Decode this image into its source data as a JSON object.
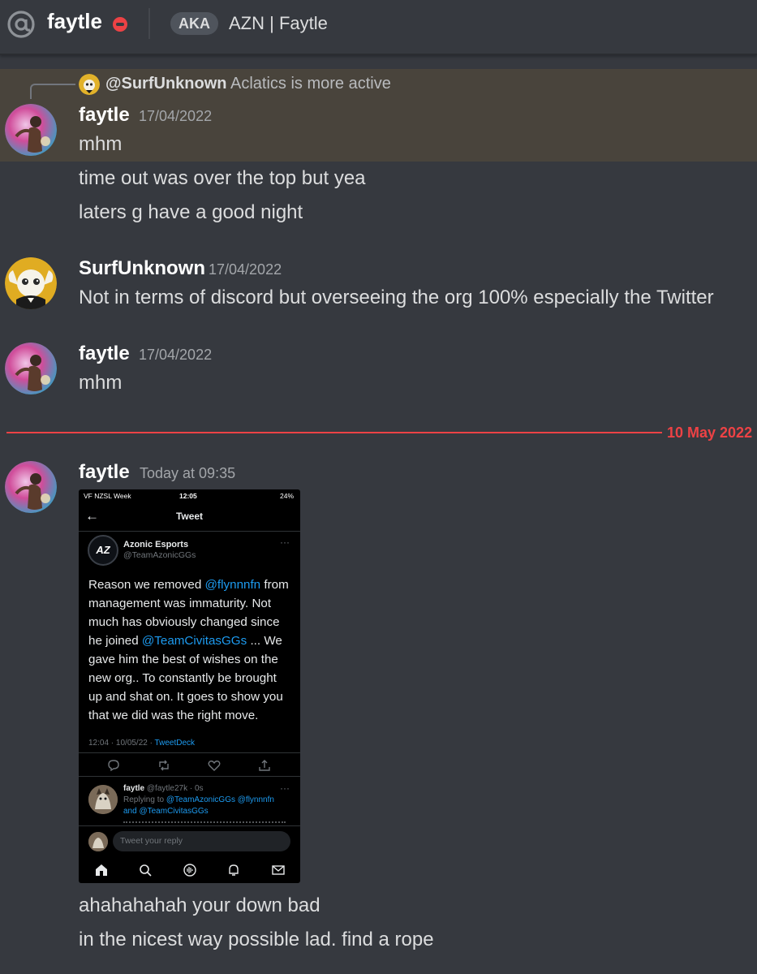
{
  "header": {
    "username": "faytle",
    "status": "do-not-disturb",
    "aka_label": "AKA",
    "nickname": "AZN | Faytle"
  },
  "reply_reference": {
    "author": "@SurfUnknown",
    "text": "Aclatics is more active"
  },
  "messages": [
    {
      "author": "faytle",
      "timestamp": "17/04/2022",
      "lines": [
        "mhm",
        "time out was over the top but yea",
        "laters g have a good night"
      ]
    },
    {
      "author": "SurfUnknown",
      "timestamp": "17/04/2022",
      "lines": [
        "Not in terms of discord but overseeing the org 100% especially the Twitter"
      ]
    },
    {
      "author": "faytle",
      "timestamp": "17/04/2022",
      "lines": [
        "mhm"
      ]
    }
  ],
  "date_divider": "10 May 2022",
  "last_message": {
    "author": "faytle",
    "timestamp": "Today at 09:35",
    "lines": [
      "ahahahahah your down bad",
      "in the nicest way possible lad. find a rope"
    ]
  },
  "screenshot": {
    "status_left": "VF NZSL Week",
    "status_time": "12:05",
    "status_battery": "24%",
    "page_title": "Tweet",
    "author_name": "Azonic Esports",
    "author_handle": "@TeamAzonicGGs",
    "avatar_text": "AZ",
    "body_lines": [
      [
        "Reason we removed ",
        "@flynnnfn",
        " from"
      ],
      [
        "management was immaturity. Not",
        "",
        ""
      ],
      [
        "much has obviously changed since",
        "",
        ""
      ],
      [
        "he joined ",
        "@TeamCivitasGGs",
        " ... We"
      ],
      [
        "gave him the best of wishes on the",
        "",
        ""
      ],
      [
        "new org.. To constantly be brought",
        "",
        ""
      ],
      [
        "up and shat on. It goes to show you",
        "",
        ""
      ],
      [
        "that we did was the right move.",
        "",
        ""
      ]
    ],
    "meta_time": "12:04 · 10/05/22 · ",
    "meta_source": "TweetDeck",
    "reply_name": "faytle",
    "reply_handle": "@faytle27k · 0s",
    "reply_to_prefix": "Replying to ",
    "reply_to_1": "@TeamAzonicGGs @flynnnfn",
    "reply_to_and": "and ",
    "reply_to_2": "@TeamCivitasGGs",
    "composer_placeholder": "Tweet your reply",
    "more_glyph": "···"
  },
  "colors": {
    "background": "#36393f",
    "highlight": "#49443c",
    "divider_red": "#ed4245",
    "mention_blue": "#1d9bf0"
  }
}
